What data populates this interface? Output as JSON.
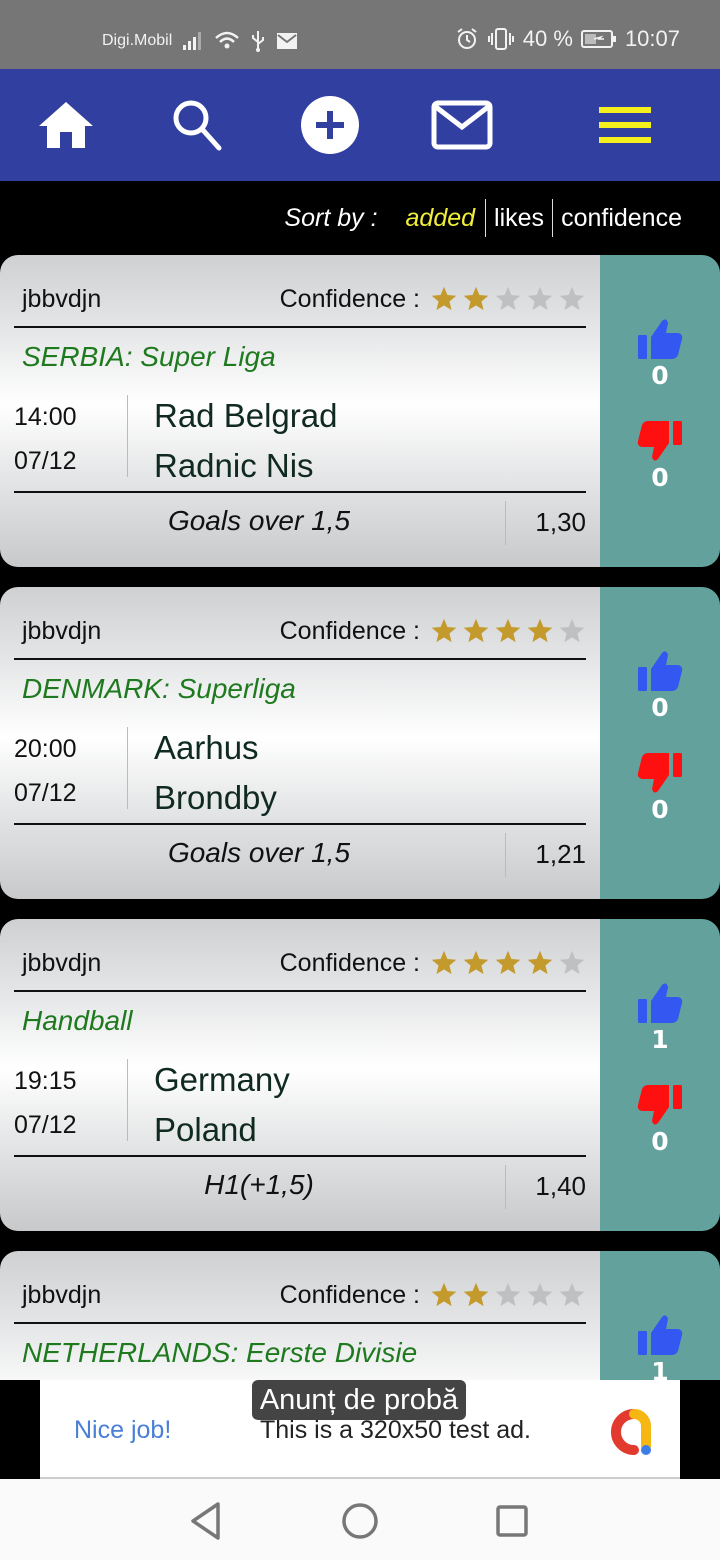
{
  "status_bar": {
    "carrier": "Digi.Mobil",
    "battery_percent": "40 %",
    "time": "10:07",
    "icons": [
      "signal-icon",
      "wifi-icon",
      "usb-icon",
      "mail-notification-icon",
      "alarm-icon",
      "vibrate-icon",
      "battery-charging-icon"
    ]
  },
  "app_bar": {
    "buttons": [
      {
        "name": "home",
        "icon": "home-icon"
      },
      {
        "name": "search",
        "icon": "search-icon"
      },
      {
        "name": "add",
        "icon": "plus-circle-icon"
      },
      {
        "name": "messages",
        "icon": "mail-icon"
      },
      {
        "name": "menu",
        "icon": "hamburger-menu-icon"
      }
    ],
    "colors": {
      "background": "#3140a0",
      "menu_icon": "#f5ef1e"
    }
  },
  "sort": {
    "label": "Sort by :",
    "options": [
      "added",
      "likes",
      "confidence"
    ],
    "active": "added",
    "active_color": "#f1ee3a"
  },
  "tips": [
    {
      "user": "jbbvdjn",
      "confidence_label": "Confidence :",
      "confidence": 2,
      "confidence_max": 5,
      "league": "SERBIA: Super Liga",
      "time": "14:00",
      "date": "07/12",
      "home": "Rad Belgrad",
      "away": "Radnic Nis",
      "tip": "Goals over 1,5",
      "odd": "1,30",
      "likes": "0",
      "dislikes": "0"
    },
    {
      "user": "jbbvdjn",
      "confidence_label": "Confidence :",
      "confidence": 4,
      "confidence_max": 5,
      "league": "DENMARK: Superliga",
      "time": "20:00",
      "date": "07/12",
      "home": "Aarhus",
      "away": "Brondby",
      "tip": "Goals over 1,5",
      "odd": "1,21",
      "likes": "0",
      "dislikes": "0"
    },
    {
      "user": "jbbvdjn",
      "confidence_label": "Confidence :",
      "confidence": 4,
      "confidence_max": 5,
      "league": "Handball",
      "time": "19:15",
      "date": "07/12",
      "home": "Germany",
      "away": "Poland",
      "tip": "H1(+1,5)",
      "odd": "1,40",
      "likes": "1",
      "dislikes": "0"
    },
    {
      "user": "jbbvdjn",
      "confidence_label": "Confidence :",
      "confidence": 2,
      "confidence_max": 5,
      "league": "NETHERLANDS: Eerste Divisie",
      "likes": "1"
    }
  ],
  "colors": {
    "star_on": "#c49a2c",
    "star_off": "#bfc0c2",
    "league_text": "#1f7a1f",
    "vote_panel": "#62a19c",
    "like": "#3357f0",
    "dislike": "#ff1010"
  },
  "ad": {
    "badge": "Anunț de probă",
    "cta": "Nice job!",
    "text": "This is a 320x50 test ad.",
    "logo": "admob-logo-icon"
  },
  "nav_bar": {
    "buttons": [
      "back-icon",
      "home-circle-icon",
      "recents-square-icon"
    ]
  }
}
